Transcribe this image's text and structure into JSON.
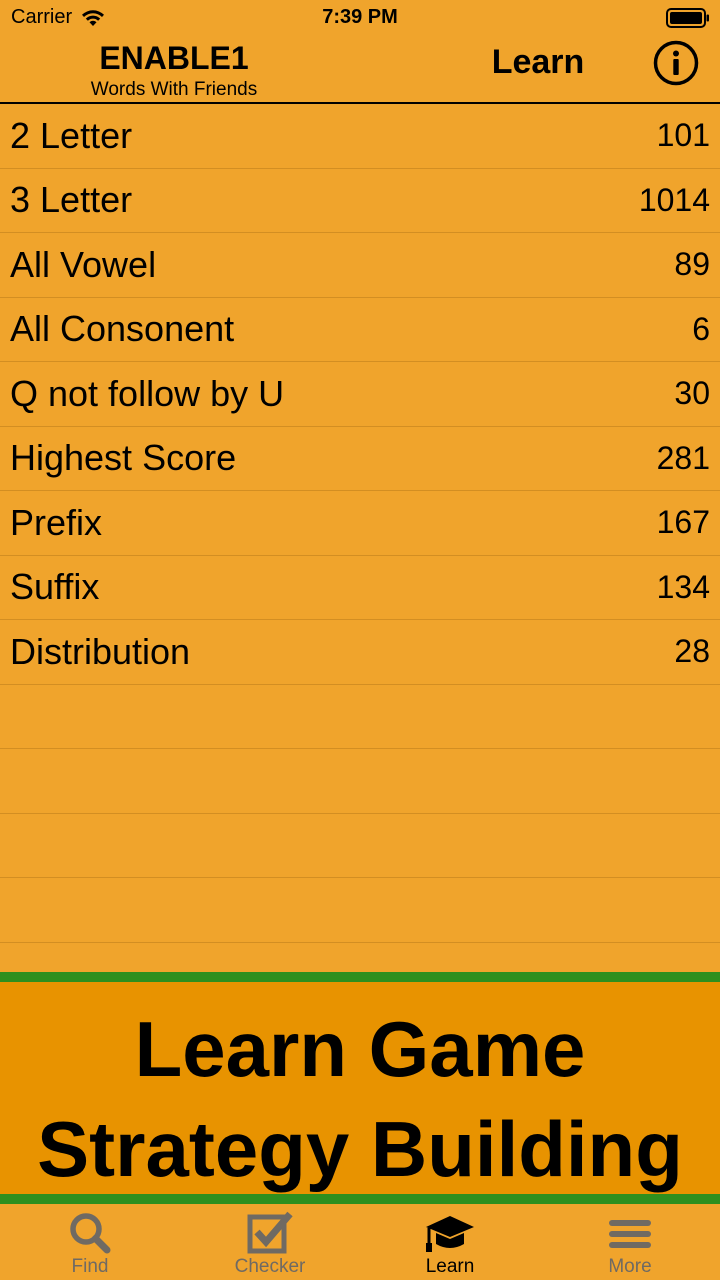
{
  "status_bar": {
    "carrier": "Carrier",
    "time": "7:39 PM"
  },
  "header": {
    "title": "ENABLE1",
    "subtitle": "Words With Friends",
    "section": "Learn"
  },
  "list": [
    {
      "label": "2 Letter",
      "count": "101"
    },
    {
      "label": "3 Letter",
      "count": "1014"
    },
    {
      "label": "All Vowel",
      "count": "89"
    },
    {
      "label": "All Consonent",
      "count": "6"
    },
    {
      "label": "Q not follow by U",
      "count": "30"
    },
    {
      "label": "Highest Score",
      "count": "281"
    },
    {
      "label": "Prefix",
      "count": "167"
    },
    {
      "label": "Suffix",
      "count": "134"
    },
    {
      "label": "Distribution",
      "count": "28"
    }
  ],
  "banner": {
    "line1": "Learn Game",
    "line2": "Strategy Building"
  },
  "tabs": [
    {
      "label": "Find",
      "icon": "search-icon"
    },
    {
      "label": "Checker",
      "icon": "checkbox-icon"
    },
    {
      "label": "Learn",
      "icon": "graduation-cap-icon"
    },
    {
      "label": "More",
      "icon": "menu-icon"
    }
  ],
  "colors": {
    "background": "#F0A42C",
    "banner": "#E89300",
    "banner_border": "#2E8F1E",
    "inactive_tab": "#6F6A63"
  }
}
